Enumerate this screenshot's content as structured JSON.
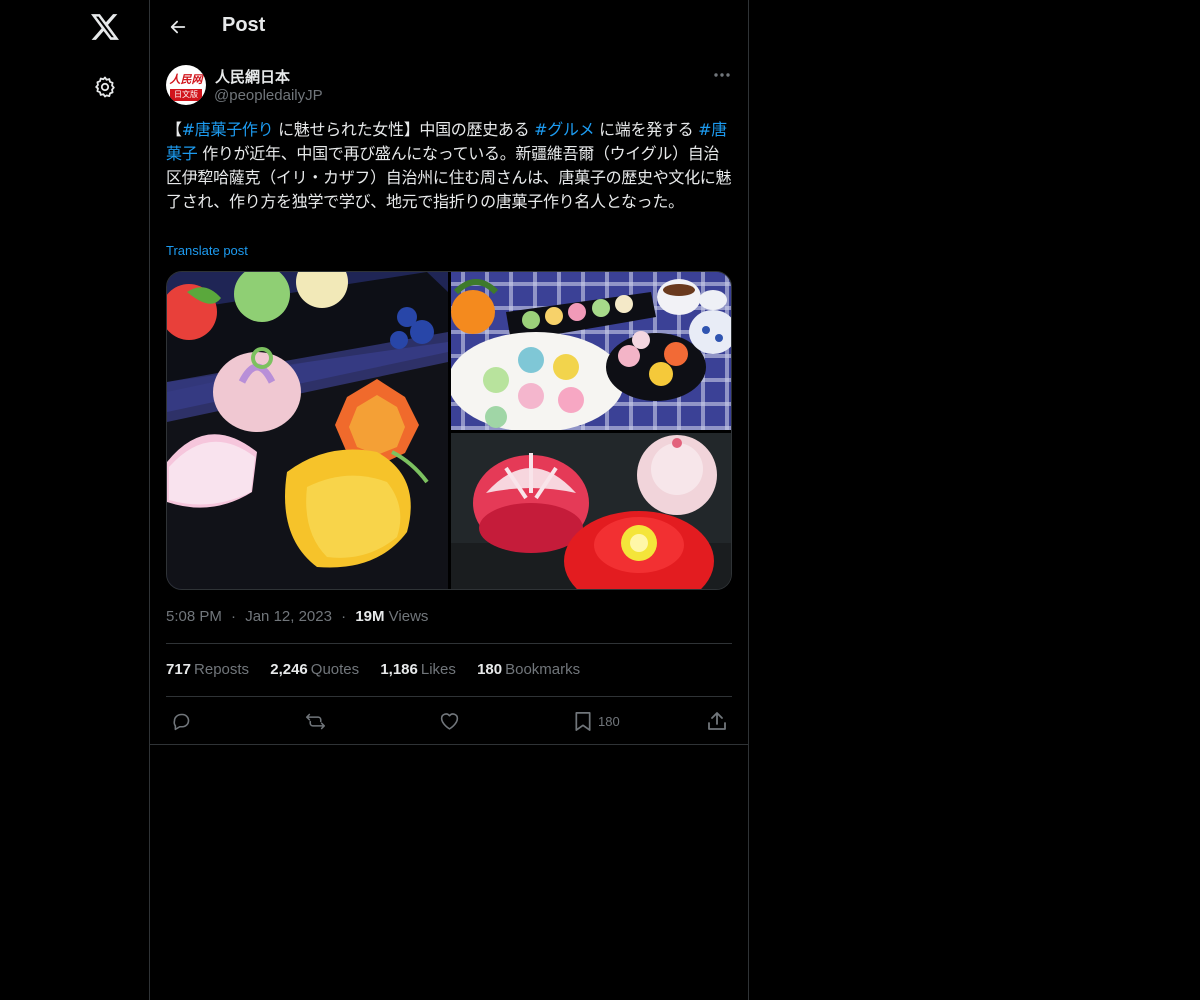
{
  "header": {
    "title": "Post"
  },
  "author": {
    "name": "人民網日本",
    "handle": "@peopledailyJP",
    "avatar_text_top": "人民网",
    "avatar_text_bottom": "日文版"
  },
  "post": {
    "t1": "【",
    "h1": "#唐菓子作り",
    "t2": " に魅せられた女性】中国の歴史ある ",
    "h2": "#グルメ",
    "t3": " に端を発する ",
    "h3": "#唐菓子",
    "t4": " 作りが近年、中国で再び盛んになっている。新疆維吾爾（ウイグル）自治区伊犂哈薩克（イリ・カザフ）自治州に住む周さんは、唐菓子の歴史や文化に魅了され、作り方を独学で学び、地元で指折りの唐菓子作り名人となった。",
    "translate_label": "Translate post"
  },
  "meta": {
    "time": "5:08 PM",
    "dot1": "·",
    "date": "Jan 12, 2023",
    "dot2": "·",
    "views_count": "19M",
    "views_label": "Views"
  },
  "stats": {
    "reposts_count": "717",
    "reposts_label": "Reposts",
    "quotes_count": "2,246",
    "quotes_label": "Quotes",
    "likes_count": "1,186",
    "likes_label": "Likes",
    "bookmarks_count": "180",
    "bookmarks_label": "Bookmarks"
  },
  "actions": {
    "bookmark_count": "180"
  },
  "colors": {
    "accent": "#1d9bf0",
    "muted": "#71767b",
    "border": "#2f3336"
  }
}
